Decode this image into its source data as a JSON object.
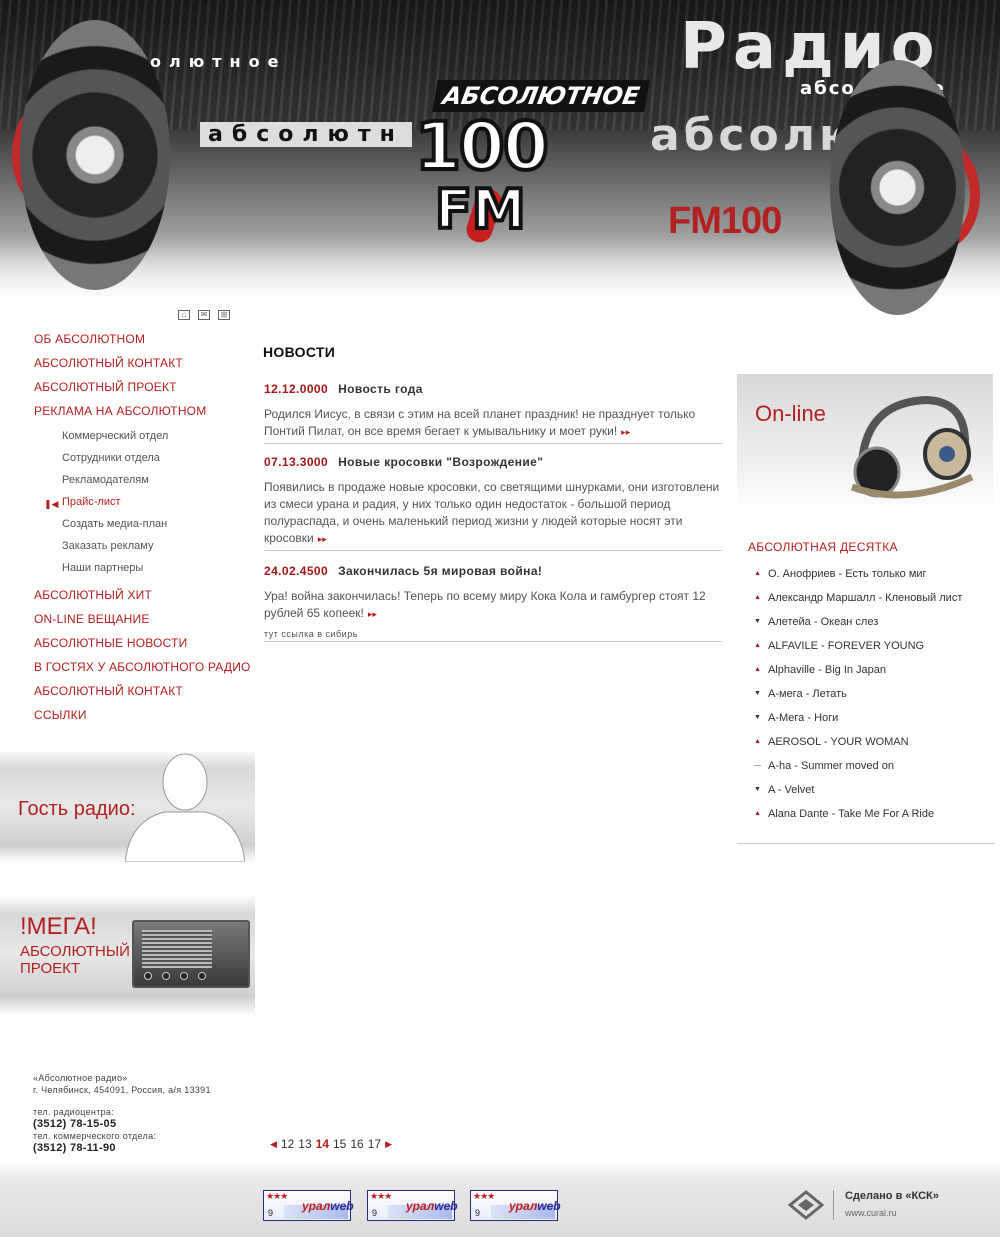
{
  "header": {
    "logo_top": "АБСОЛЮТНОЕ",
    "logo_main": "100",
    "logo_fm": "FM",
    "fm100": "FM100",
    "bg_text_1": "Радио",
    "bg_text_2": "абсолюте",
    "bg_text_3": "олютное",
    "bg_text_4": "абсолютн",
    "bg_text_5": "абсолютное",
    "icons": [
      "home-icon",
      "mail-icon",
      "sitemap-icon"
    ]
  },
  "nav": {
    "main_top": [
      "ОБ АБСОЛЮТНОМ",
      "АБСОЛЮТНЫЙ  КОНТАКТ",
      "АБСОЛЮТНЫЙ ПРОЕКТ",
      "РЕКЛАМА НА АБСОЛЮТНОМ"
    ],
    "sub": [
      "Коммерческий  отдел",
      "Сотрудники отдела",
      "Рекламодателям",
      "Прайс-лист",
      "Создать медиа-план",
      "Заказать рекламу",
      "Наши партнеры"
    ],
    "active_marker": "❚◀",
    "main_bottom": [
      "АБСОЛЮТНЫЙ ХИТ",
      "ON-LINE ВЕЩАНИЕ",
      "АБСОЛЮТНЫЕ НОВОСТИ",
      "В ГОСТЯХ У АБСОЛЮТНОГО РАДИО",
      "АБСОЛЮТНЫЙ КОНТАКТ",
      "ССЫЛКИ"
    ]
  },
  "promos": {
    "guest": "Гость радио:",
    "mega_title": "!МЕГА!",
    "mega_sub": "АБСОЛЮТНЫЙ ПРОЕКТ"
  },
  "contacts": {
    "name": "«Абсолютное радио»",
    "address": "г. Челябинск, 454091, Россия, а/я 13391",
    "label1": "тел. радиоцентра:",
    "phone1": "(3512) 78-15-05",
    "label2": "тел. коммерческого отдела:",
    "phone2": "(3512) 78-11-90"
  },
  "news": {
    "title": "НОВОСТИ",
    "items": [
      {
        "date": "12.12.0000",
        "title": "Новость года",
        "body": "Родился Иисус, в связи с этим на всей планет праздник! не празднует только Понтий Пилат, он все время бегает к умывальнику и моет руки!"
      },
      {
        "date": "07.13.3000",
        "title": "Новые кросовки \"Возрождение\"",
        "body": "Появились в продаже новые кросовки, со светящими шнурками, они изготовлени из смеси урана и радия, у них только один недостаток - большой период полураспада, и очень маленький период жизни у людей которые носят эти кросовки"
      },
      {
        "date": "24.02.4500",
        "title": "Закончилась 5я мировая война!",
        "body": "Ура! война закончилась! Теперь по всему миру Кока Кола и гамбургер стоят 12 рублей 65 копеек!",
        "link": "тут ссылка в сибирь"
      }
    ],
    "more_glyph": "▸▸"
  },
  "pager": {
    "prev": "◀",
    "pages": [
      "12",
      "13",
      "14",
      "15",
      "16",
      "17"
    ],
    "current": "14",
    "next": "▶"
  },
  "online": {
    "title": "On-line"
  },
  "top10": {
    "title": "АБСОЛЮТНАЯ ДЕСЯТКА",
    "items": [
      {
        "trend": "up",
        "text": "О. Анофриев - Есть только миг"
      },
      {
        "trend": "up",
        "text": "Александр Маршалл - Кленовый лист"
      },
      {
        "trend": "down",
        "text": "Алетейа - Океан слез"
      },
      {
        "trend": "up",
        "text": "ALFAVILE - FOREVER YOUNG"
      },
      {
        "trend": "up",
        "text": "Alphaville - Big In Japan"
      },
      {
        "trend": "down",
        "text": "А-мега - Летать"
      },
      {
        "trend": "down",
        "text": "А-Мега - Ноги"
      },
      {
        "trend": "up",
        "text": "AEROSOL - YOUR WOMAN"
      },
      {
        "trend": "same",
        "text": "A-ha - Summer moved on"
      },
      {
        "trend": "down",
        "text": "A - Velvet"
      },
      {
        "trend": "up",
        "text": "Alana Dante - Take Me For A Ride"
      }
    ]
  },
  "footer": {
    "counters": [
      {
        "stars": "★★★",
        "num": "9",
        "brand_a": "урал",
        "brand_b": "web"
      },
      {
        "stars": "★★★",
        "num": "9",
        "brand_a": "урал",
        "brand_b": "web"
      },
      {
        "stars": "★★★",
        "num": "9",
        "brand_a": "урал",
        "brand_b": "web"
      }
    ],
    "made_by": "Сделано в «КСК»",
    "made_url": "www.cural.ru"
  },
  "colors": {
    "accent": "#b41e1e",
    "text": "#333333"
  }
}
